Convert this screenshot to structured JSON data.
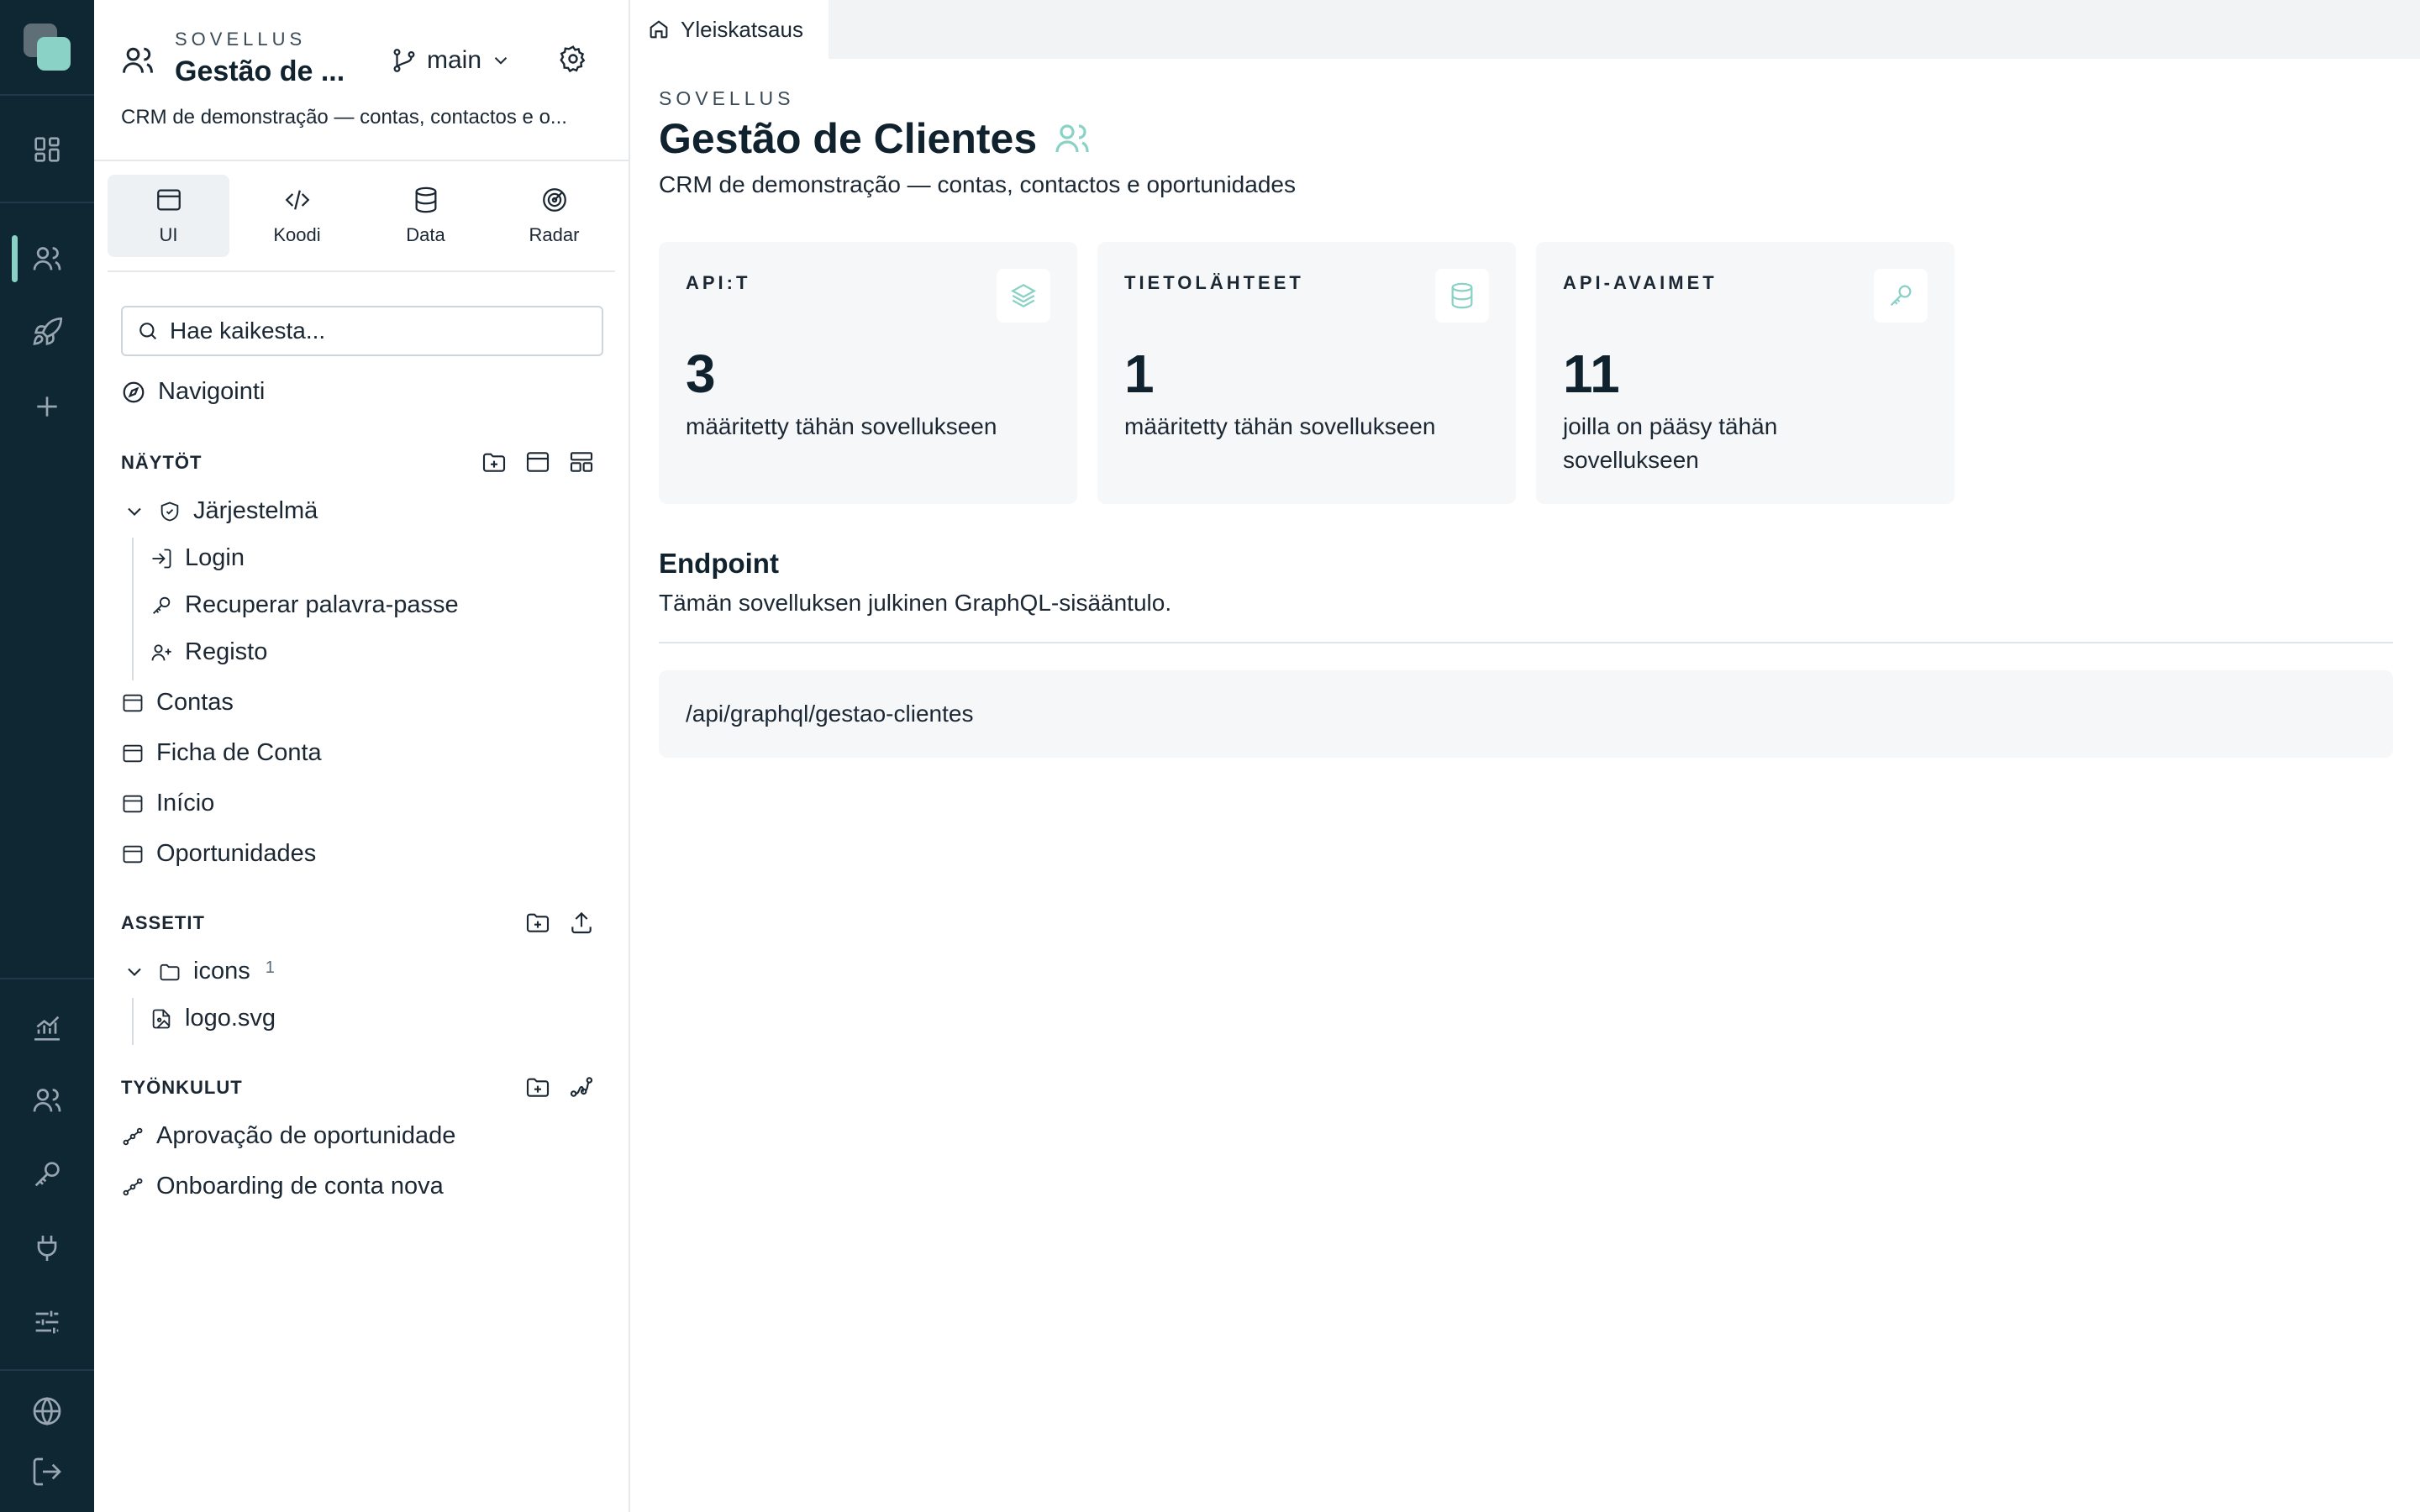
{
  "sidebar": {
    "kicker": "SOVELLUS",
    "app_title": "Gestão de ...",
    "branch": "main",
    "description": "CRM de demonstração — contas, contactos e o...",
    "tabs": [
      {
        "label": "UI",
        "icon": "window-icon",
        "active": true
      },
      {
        "label": "Koodi",
        "icon": "code-icon",
        "active": false
      },
      {
        "label": "Data",
        "icon": "database-icon",
        "active": false
      },
      {
        "label": "Radar",
        "icon": "radar-icon",
        "active": false
      }
    ],
    "search_placeholder": "Hae kaikesta...",
    "navigation_label": "Navigointi",
    "screens": {
      "title": "NÄYTÖT",
      "group": "Järjestelmä",
      "group_children": [
        "Login",
        "Recuperar palavra-passe",
        "Registo"
      ],
      "items": [
        "Contas",
        "Ficha de Conta",
        "Início",
        "Oportunidades"
      ]
    },
    "assets": {
      "title": "ASSETIT",
      "folder": "icons",
      "folder_count": "1",
      "file": "logo.svg"
    },
    "workflows": {
      "title": "TYÖNKULUT",
      "items": [
        "Aprovação de oportunidade",
        "Onboarding de conta nova"
      ]
    }
  },
  "main": {
    "tab_label": "Yleiskatsaus",
    "kicker": "SOVELLUS",
    "title": "Gestão de Clientes",
    "subtitle": "CRM de demonstração — contas, contactos e oportunidades",
    "cards": [
      {
        "label": "API:T",
        "value": "3",
        "caption": "määritetty tähän sovellukseen",
        "icon": "layers-icon"
      },
      {
        "label": "TIETOLÄHTEET",
        "value": "1",
        "caption": "määritetty tähän sovellukseen",
        "icon": "database-icon"
      },
      {
        "label": "API-AVAIMET",
        "value": "11",
        "caption": "joilla on pääsy tähän sovellukseen",
        "icon": "key-icon"
      }
    ],
    "endpoint": {
      "title": "Endpoint",
      "subtitle": "Tämän sovelluksen julkinen GraphQL-sisääntulo.",
      "path": "/api/graphql/gestao-clientes"
    }
  },
  "colors": {
    "rail_bg": "#0f2733",
    "accent": "#8ad1c6",
    "card_bg": "#f5f7f9",
    "topbar_bg": "#f2f3f5"
  }
}
